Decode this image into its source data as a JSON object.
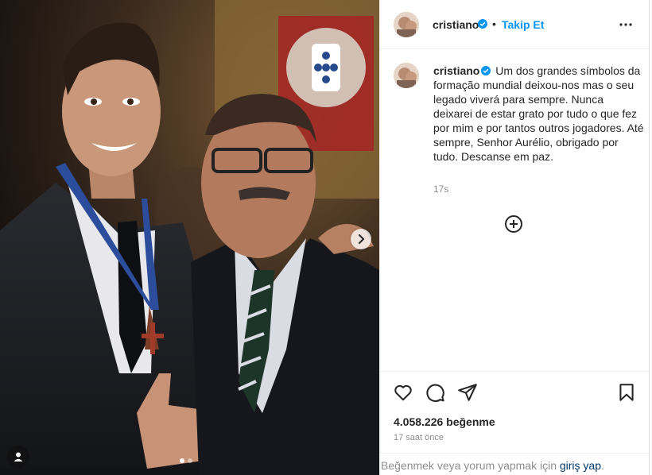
{
  "post": {
    "username": "cristiano",
    "follow_label": "Takip Et",
    "bullet": "•",
    "caption": "Um dos grandes símbolos da formação mundial deixou-nos mas o seu legado viverá para sempre. Nunca deixarei de estar grato por tudo o que fez por mim e por tantos outros jogadores. Até sempre, Senhor Aurélio, obrigado por tudo. Descanse em paz.",
    "time_ago": "17s",
    "likes": "4.058.226 beğenme",
    "posted": "17 saat önce"
  },
  "login_bar": {
    "prefix": "Beğenmek veya yorum yapmak için ",
    "link": "giriş yap",
    "suffix": "."
  },
  "carousel": {
    "current": 1,
    "total": 2
  },
  "icons": {
    "verified": "verified-badge-icon",
    "more": "more-options-icon",
    "add_comment": "add-circle-icon",
    "like": "heart-icon",
    "comment": "comment-icon",
    "share": "share-icon",
    "save": "bookmark-icon",
    "tags": "user-tag-icon",
    "next": "chevron-right-icon"
  },
  "colors": {
    "accent": "#0095f6",
    "text": "#262626",
    "muted": "#8e8e8e",
    "link": "#00376b"
  }
}
